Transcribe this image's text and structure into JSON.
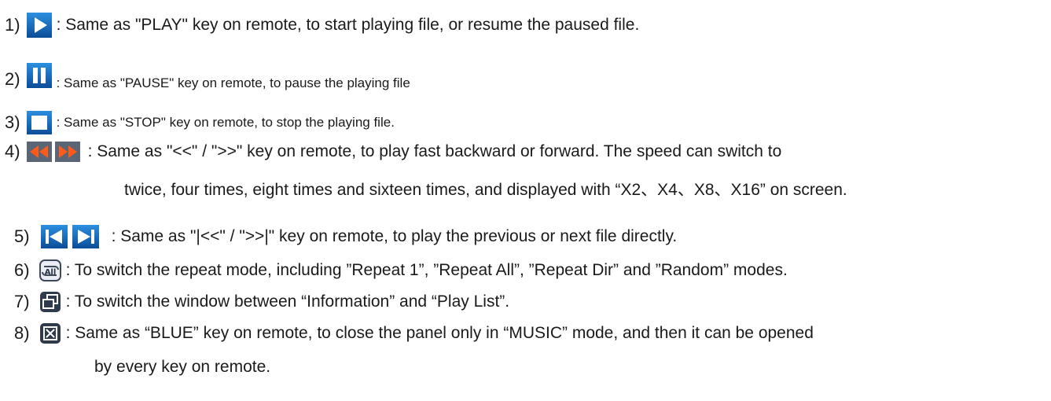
{
  "items": [
    {
      "num": "1)",
      "icons": [
        "play-icon"
      ],
      "text": ": Same as \"PLAY\" key on remote, to start playing file,  or resume the paused file."
    },
    {
      "num": "2)",
      "icons": [
        "pause-icon"
      ],
      "text": ": Same as \"PAUSE\" key on remote, to pause the playing file"
    },
    {
      "num": "3)",
      "icons": [
        "stop-icon"
      ],
      "text": ": Same as \"STOP\" key on remote, to stop the playing file."
    },
    {
      "num": "4)",
      "icons": [
        "fast-backward-icon",
        "fast-forward-icon"
      ],
      "text": ": Same as \"<<\" / \">>\" key on remote, to play fast  backward or forward. The speed can switch to",
      "continuation": "twice, four times, eight times and sixteen times, and displayed with “X2、X4、X8、X16” on screen."
    },
    {
      "num": "5)",
      "icons": [
        "previous-track-icon",
        "next-track-icon"
      ],
      "text": ": Same as \"|<<\" / \">>|\" key on remote, to play the previous or next file directly."
    },
    {
      "num": "6)",
      "icons": [
        "repeat-all-icon"
      ],
      "text": ": To switch the repeat mode, including ”Repeat 1”, ”Repeat All”, ”Repeat Dir” and ”Random” modes."
    },
    {
      "num": "7)",
      "icons": [
        "window-switch-icon"
      ],
      "text": ": To switch the window between “Information” and “Play List”."
    },
    {
      "num": "8)",
      "icons": [
        "close-panel-icon"
      ],
      "text": ": Same as “BLUE” key on remote, to close the panel only in “MUSIC” mode, and then it can be opened",
      "continuation": "by every key on remote."
    }
  ],
  "icon_labels": {
    "repeat_all": "All"
  }
}
